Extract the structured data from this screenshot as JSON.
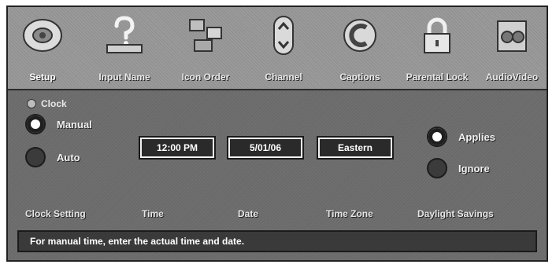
{
  "tabs": [
    {
      "label": "Setup",
      "icon": "setup-icon",
      "active": true
    },
    {
      "label": "Input Name",
      "icon": "input-name-icon",
      "active": false
    },
    {
      "label": "Icon Order",
      "icon": "icon-order-icon",
      "active": false
    },
    {
      "label": "Channel",
      "icon": "channel-icon",
      "active": false
    },
    {
      "label": "Captions",
      "icon": "captions-icon",
      "active": false
    },
    {
      "label": "Parental Lock",
      "icon": "parental-lock-icon",
      "active": false
    },
    {
      "label": "AudioVideo",
      "icon": "audio-video-icon",
      "active": false
    }
  ],
  "clock": {
    "section_title": "Clock",
    "mode_options": [
      {
        "label": "Manual",
        "selected": true
      },
      {
        "label": "Auto",
        "selected": false
      }
    ],
    "time": "12:00 PM",
    "date": "5/01/06",
    "time_zone": "Eastern",
    "dst_options": [
      {
        "label": "Applies",
        "selected": true
      },
      {
        "label": "Ignore",
        "selected": false
      }
    ]
  },
  "labels": {
    "clock_setting": "Clock Setting",
    "time": "Time",
    "date": "Date",
    "time_zone": "Time Zone",
    "daylight_savings": "Daylight Savings"
  },
  "help_text": "For manual time, enter the actual time and date."
}
